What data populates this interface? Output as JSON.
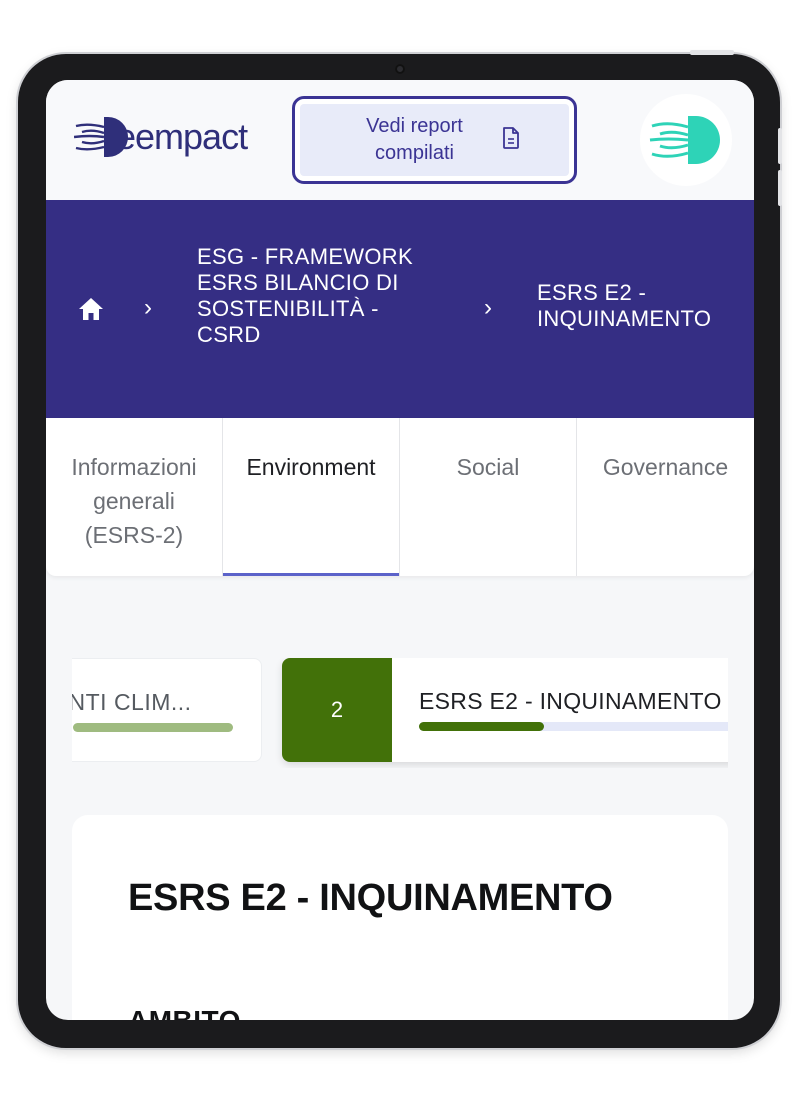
{
  "header": {
    "logo_text": "eempact",
    "report_button_label": "Vedi report compilati",
    "report_button_icon": "document-icon",
    "avatar_icon": "brand-logo-icon"
  },
  "breadcrumb": {
    "home_icon": "home-icon",
    "items": [
      {
        "label": "ESG - FRAMEWORK ESRS BILANCIO DI SOSTENIBILITÀ - CSRD"
      },
      {
        "label": "ESRS E2 - INQUINAMENTO"
      }
    ]
  },
  "tabs": [
    {
      "label": "Informazioni generali (ESRS-2)",
      "active": false
    },
    {
      "label": "Environment",
      "active": true
    },
    {
      "label": "Social",
      "active": false
    },
    {
      "label": "Governance",
      "active": false
    }
  ],
  "stepper": {
    "previous": {
      "label": "MENTI CLIM...",
      "progress": 1.0
    },
    "current": {
      "number": "2",
      "label": "ESRS E2 - INQUINAMENTO",
      "progress": 0.38
    }
  },
  "content": {
    "title": "ESRS E2 - INQUINAMENTO",
    "section_heading": "AMBITO"
  },
  "colors": {
    "primary": "#352e84",
    "step_active": "#427109",
    "step_done": "#9fbb80",
    "brand_teal": "#2ed3b7"
  }
}
